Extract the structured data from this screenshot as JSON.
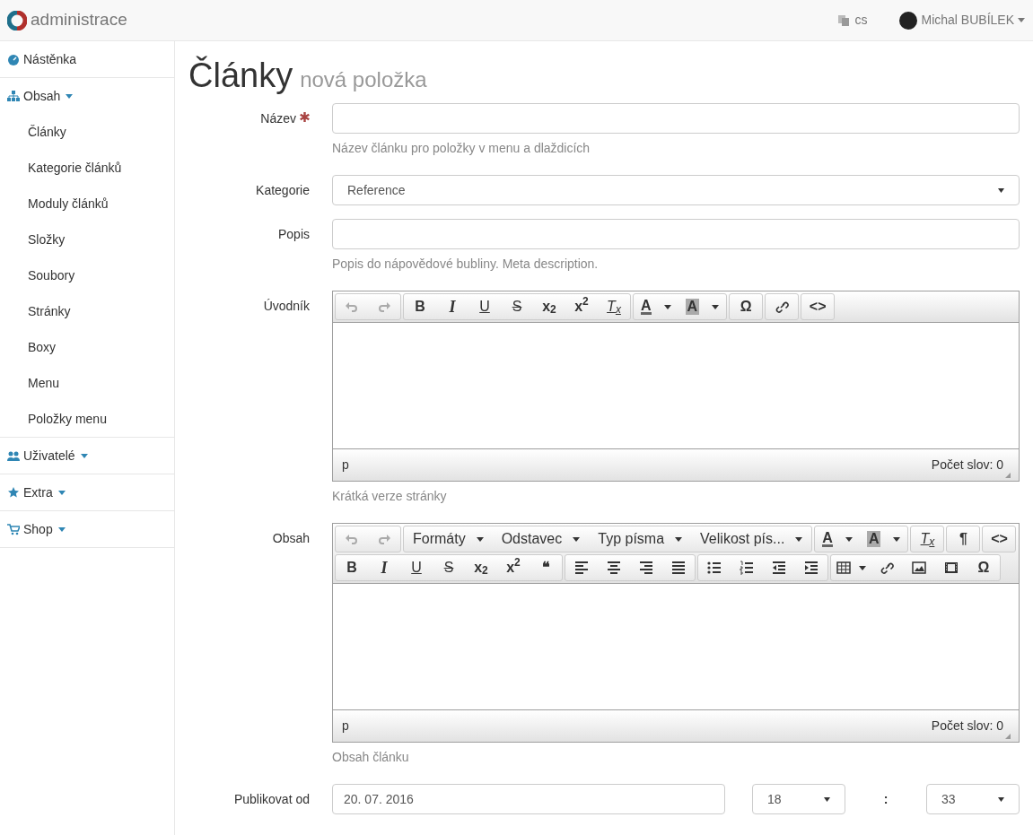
{
  "navbar": {
    "brand": "administrace",
    "language": "cs",
    "user": "Michal BUBÍLEK"
  },
  "sidebar": {
    "items": [
      {
        "kind": "dashboard",
        "label": "Nástěnka"
      },
      {
        "kind": "sitemap",
        "label": "Obsah",
        "dropdown": true,
        "expanded": true,
        "children": [
          {
            "label": "Články"
          },
          {
            "label": "Kategorie článků"
          },
          {
            "label": "Moduly článků"
          },
          {
            "label": "Složky"
          },
          {
            "label": "Soubory"
          },
          {
            "label": "Stránky"
          },
          {
            "label": "Boxy"
          },
          {
            "label": "Menu"
          },
          {
            "label": "Položky menu"
          }
        ]
      },
      {
        "kind": "users",
        "label": "Uživatelé",
        "dropdown": true
      },
      {
        "kind": "star",
        "label": "Extra",
        "dropdown": true
      },
      {
        "kind": "cart",
        "label": "Shop",
        "dropdown": true
      }
    ]
  },
  "page": {
    "title": "Články",
    "subtitle": "nová položka"
  },
  "form": {
    "fields": [
      {
        "kind": "input",
        "label": "Název",
        "required": true,
        "help": "Název článku pro položky v menu a dlaždicích"
      },
      {
        "kind": "select",
        "label": "Kategorie",
        "value": "Reference"
      },
      {
        "kind": "input",
        "label": "Popis",
        "help": "Popis do nápovědové bubliny. Meta description."
      },
      {
        "kind": "editor",
        "label": "Úvodník",
        "help": "Krátká verze stránky",
        "status_path": "p",
        "word_count": "Počet slov: 0",
        "toolbar_rows": [
          [
            [
              {
                "kind": "undo",
                "disabled": true
              },
              {
                "kind": "redo",
                "disabled": true
              }
            ],
            [
              {
                "kind": "bold",
                "text": "B"
              },
              {
                "kind": "italic",
                "text": "I"
              },
              {
                "kind": "underline",
                "text": "U"
              },
              {
                "kind": "strike",
                "text": "S"
              },
              {
                "kind": "glyph",
                "text": "x$_{2}$"
              },
              {
                "kind": "glyph",
                "text": "x$^{2}$"
              },
              {
                "kind": "removeformat",
                "text": "T$_{x}$"
              }
            ],
            [
              {
                "kind": "forecolor",
                "text": "A"
              },
              {
                "kind": "backcolor",
                "text": "A"
              }
            ],
            [
              {
                "kind": "glyph",
                "text": "Ω"
              }
            ],
            [
              {
                "kind": "link"
              }
            ],
            [
              {
                "kind": "glyph",
                "text": "<>"
              }
            ]
          ]
        ]
      },
      {
        "kind": "editor",
        "label": "Obsah",
        "help": "Obsah článku",
        "status_path": "p",
        "word_count": "Počet slov: 0",
        "toolbar_rows": [
          [
            [
              {
                "kind": "undo",
                "disabled": true
              },
              {
                "kind": "redo",
                "disabled": true
              }
            ],
            [
              {
                "kind": "dropdown",
                "text": "Formáty"
              },
              {
                "kind": "dropdown",
                "text": "Odstavec"
              },
              {
                "kind": "dropdown",
                "text": "Typ písma"
              },
              {
                "kind": "dropdown",
                "text": "Velikost pís..."
              }
            ],
            [
              {
                "kind": "forecolor",
                "text": "A"
              },
              {
                "kind": "backcolor",
                "text": "A"
              }
            ],
            [
              {
                "kind": "removeformat",
                "text": "T$_{x}$"
              }
            ],
            [
              {
                "kind": "glyph",
                "text": "¶"
              }
            ],
            [
              {
                "kind": "glyph",
                "text": "<>"
              }
            ]
          ],
          [
            [
              {
                "kind": "bold",
                "text": "B"
              },
              {
                "kind": "italic",
                "text": "I"
              },
              {
                "kind": "underline",
                "text": "U"
              },
              {
                "kind": "strike",
                "text": "S"
              },
              {
                "kind": "glyph",
                "text": "x$_{2}$"
              },
              {
                "kind": "glyph",
                "text": "x$^{2}$"
              },
              {
                "kind": "glyph",
                "text": "❝"
              }
            ],
            [
              {
                "kind": "align-left"
              },
              {
                "kind": "align-center"
              },
              {
                "kind": "align-right"
              },
              {
                "kind": "justify"
              }
            ],
            [
              {
                "kind": "bullist"
              },
              {
                "kind": "numlist"
              },
              {
                "kind": "outdent"
              },
              {
                "kind": "indent"
              }
            ],
            [
              {
                "kind": "table"
              },
              {
                "kind": "link"
              },
              {
                "kind": "image"
              },
              {
                "kind": "media"
              },
              {
                "kind": "glyph",
                "text": "Ω"
              }
            ]
          ]
        ]
      },
      {
        "kind": "datetime",
        "label": "Publikovat od",
        "date": "20. 07. 2016",
        "hour": "18",
        "separator": ":",
        "minute": "33"
      }
    ]
  }
}
